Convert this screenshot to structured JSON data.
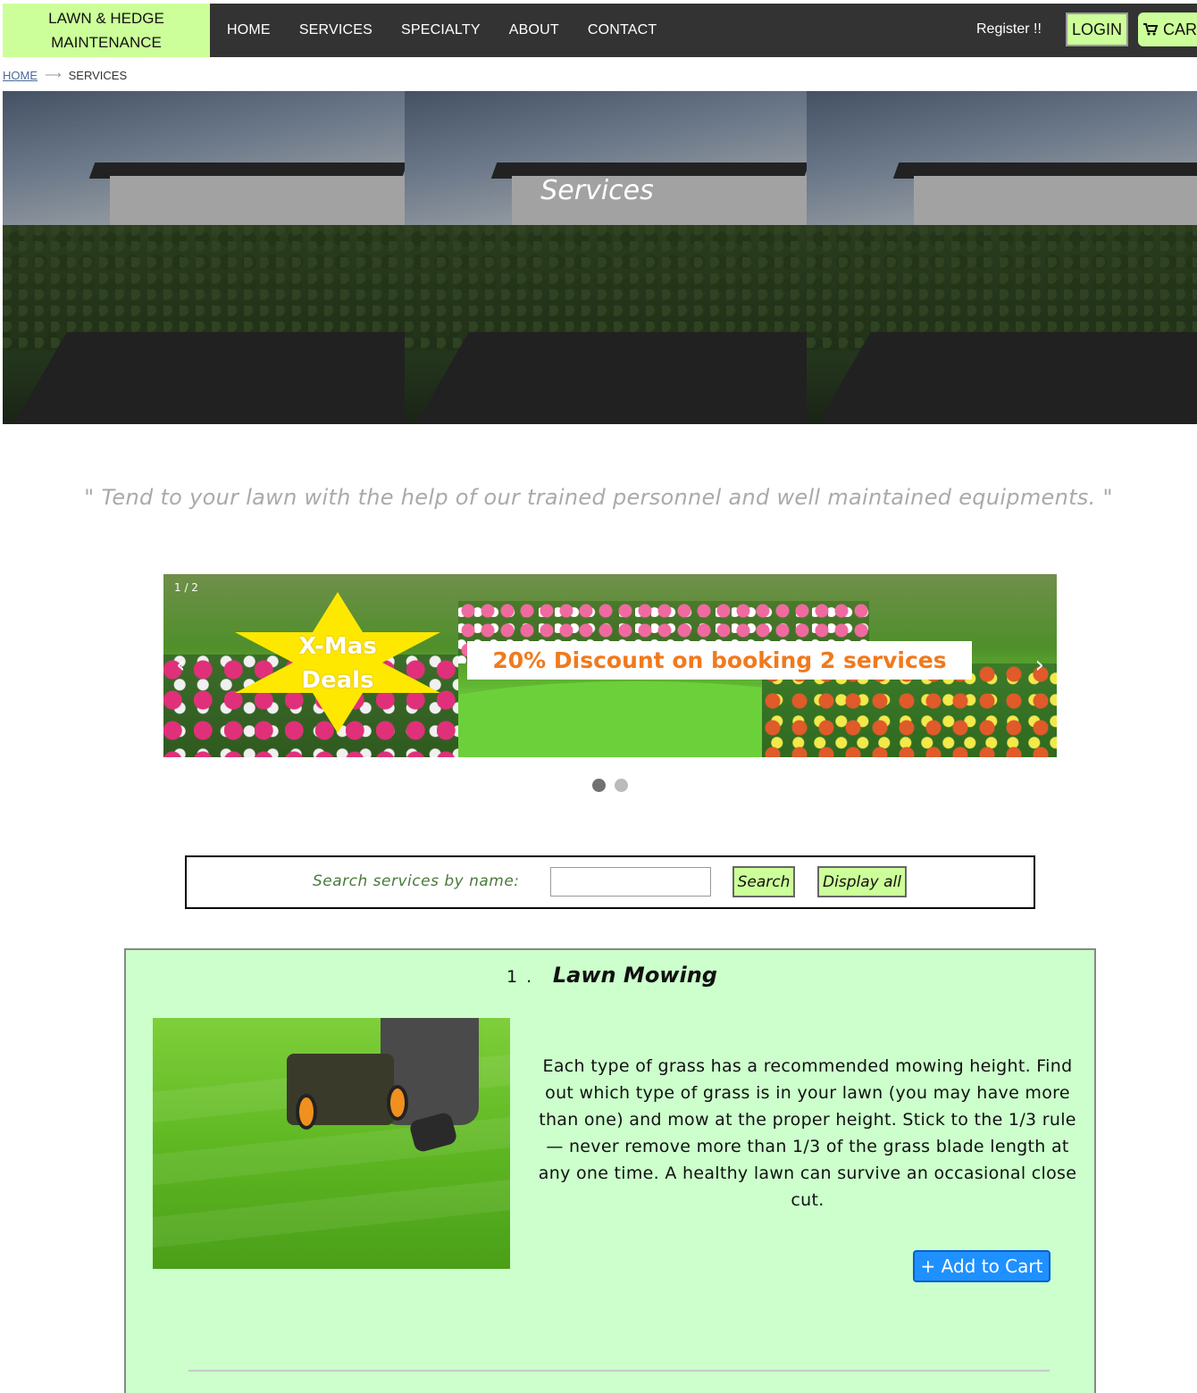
{
  "brand": {
    "line1": "LAWN & HEDGE",
    "line2": "MAINTENANCE"
  },
  "nav": {
    "items": [
      {
        "label": "HOME"
      },
      {
        "label": "SERVICES"
      },
      {
        "label": "SPECIALTY"
      },
      {
        "label": "ABOUT"
      },
      {
        "label": "CONTACT"
      }
    ],
    "register": "Register !!",
    "login": "LOGIN",
    "cart": "CART",
    "icons": {
      "cart": "shopping-cart-icon"
    }
  },
  "breadcrumb": {
    "home": "HOME",
    "current": "SERVICES"
  },
  "hero": {
    "title": "Services"
  },
  "quote": "\" Tend to your lawn with the help of our trained personnel and well maintained equipments. \"",
  "promo": {
    "counter": "1 / 2",
    "star_line1": "X-Mas",
    "star_line2": "Deals",
    "banner": "20% Discount on booking 2 services",
    "prev": "‹",
    "next": "›",
    "slide_index": 1,
    "slide_count": 2
  },
  "search": {
    "label": "Search services by name:",
    "value": "",
    "search_button": "Search",
    "display_all_button": "Display all"
  },
  "services": [
    {
      "number": "1 .",
      "name": "Lawn Mowing",
      "description": "Each type of grass has a recommended mowing height. Find out which type of grass is in your lawn (you may have more than one) and mow at the proper height. Stick to the 1/3 rule — never remove more than 1/3 of the grass blade length at any one time. A healthy lawn can survive an occasional close cut.",
      "add_to_cart": "+ Add to Cart"
    }
  ],
  "colors": {
    "brand_bg": "#ccff99",
    "nav_bg": "#333333",
    "card_bg": "#ccffcc",
    "add_cart": "#1e90ff",
    "banner_text": "#f07a1e",
    "quote_text": "#aaaaaa"
  }
}
